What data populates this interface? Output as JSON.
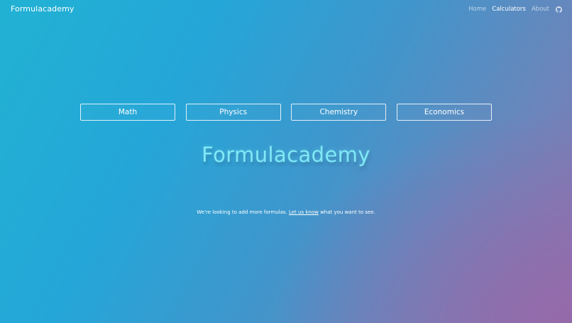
{
  "header": {
    "brand": "Formulacademy",
    "nav": {
      "home": "Home",
      "calculators": "Calculators",
      "about": "About",
      "github_icon": "github-icon"
    }
  },
  "categories": [
    {
      "label": "Math"
    },
    {
      "label": "Physics"
    },
    {
      "label": "Chemistry"
    },
    {
      "label": "Economics"
    }
  ],
  "hero": {
    "title": "Formulacademy"
  },
  "tagline": {
    "before": "We're looking to add more formulas. ",
    "link": "Let us know",
    "after": " what you want to see."
  },
  "colors": {
    "gradient_start": "#21b2d3",
    "gradient_mid": "#3f96cc",
    "gradient_end": "#8a75b0",
    "hero_text": "#7fe9f7"
  }
}
